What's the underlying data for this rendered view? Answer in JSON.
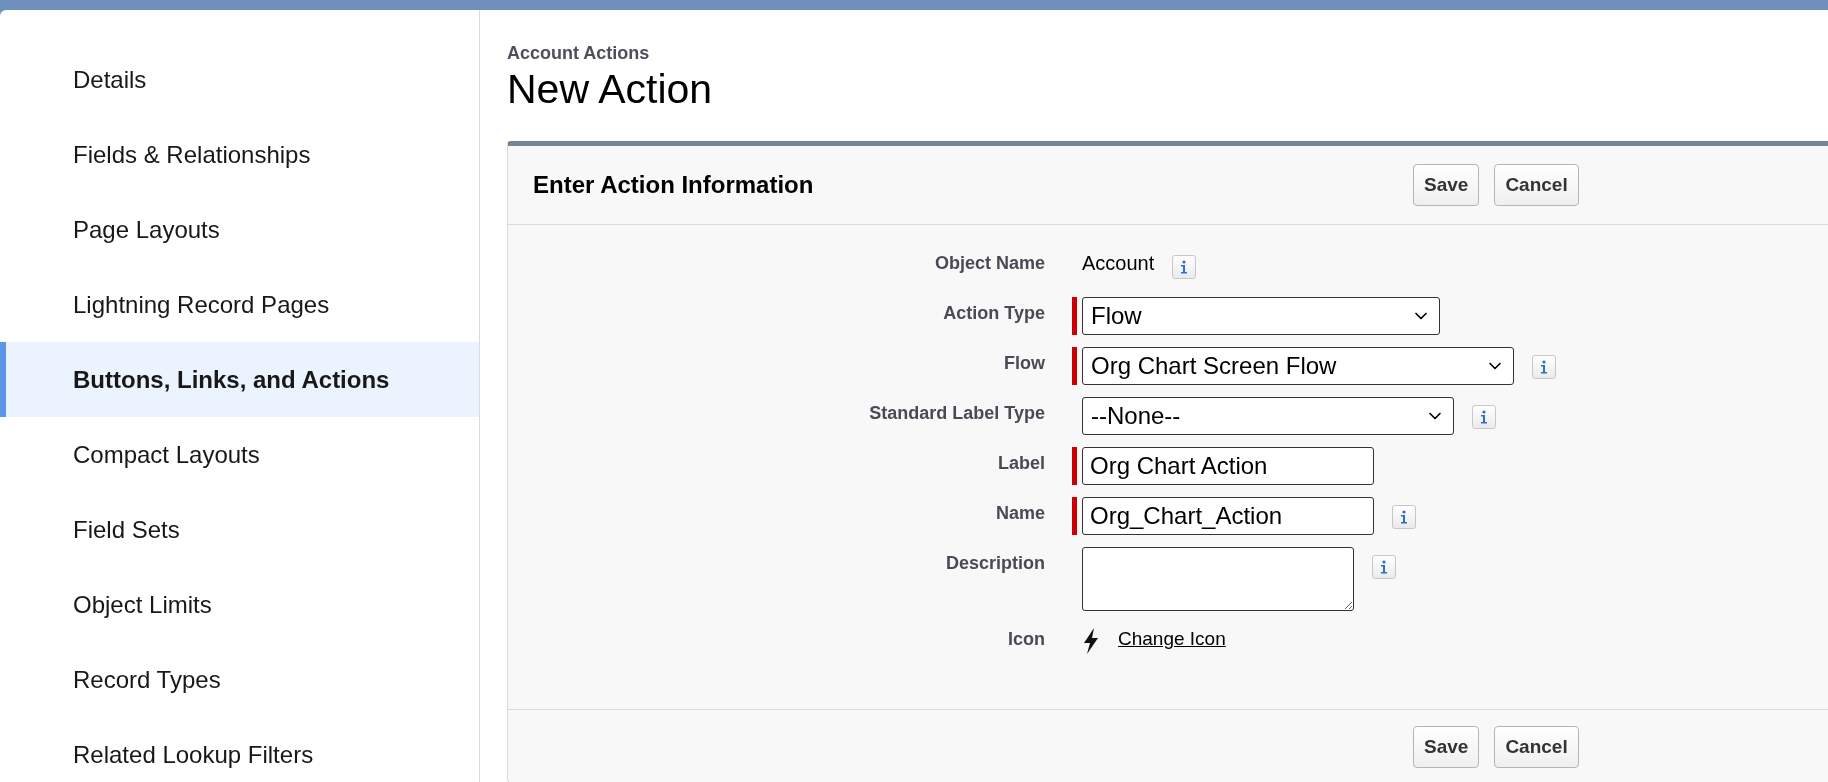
{
  "sidebar": {
    "items": [
      {
        "label": "Details",
        "selected": false
      },
      {
        "label": "Fields & Relationships",
        "selected": false
      },
      {
        "label": "Page Layouts",
        "selected": false
      },
      {
        "label": "Lightning Record Pages",
        "selected": false
      },
      {
        "label": "Buttons, Links, and Actions",
        "selected": true
      },
      {
        "label": "Compact Layouts",
        "selected": false
      },
      {
        "label": "Field Sets",
        "selected": false
      },
      {
        "label": "Object Limits",
        "selected": false
      },
      {
        "label": "Record Types",
        "selected": false
      },
      {
        "label": "Related Lookup Filters",
        "selected": false
      }
    ]
  },
  "header": {
    "breadcrumb": "Account Actions",
    "title": "New Action"
  },
  "panel": {
    "title": "Enter Action Information",
    "buttons": [
      "Save",
      "Cancel"
    ],
    "fields": [
      {
        "kind": "text",
        "label": "Object Name",
        "value": "Account",
        "required": false,
        "info": true
      },
      {
        "kind": "select",
        "label": "Action Type",
        "value": "Flow",
        "required": true,
        "info": false
      },
      {
        "kind": "select",
        "label": "Flow",
        "value": "Org Chart Screen Flow",
        "required": true,
        "info": true
      },
      {
        "kind": "select",
        "label": "Standard Label Type",
        "value": "--None--",
        "required": false,
        "info": true
      },
      {
        "kind": "input",
        "label": "Label",
        "value": "Org Chart Action",
        "required": true,
        "info": false
      },
      {
        "kind": "input",
        "label": "Name",
        "value": "Org_Chart_Action",
        "required": true,
        "info": true
      },
      {
        "kind": "textarea",
        "label": "Description",
        "required": false,
        "info": true
      },
      {
        "kind": "icon",
        "label": "Icon",
        "link": "Change Icon",
        "required": false,
        "info": false
      }
    ],
    "footer_buttons": [
      "Save",
      "Cancel"
    ]
  }
}
